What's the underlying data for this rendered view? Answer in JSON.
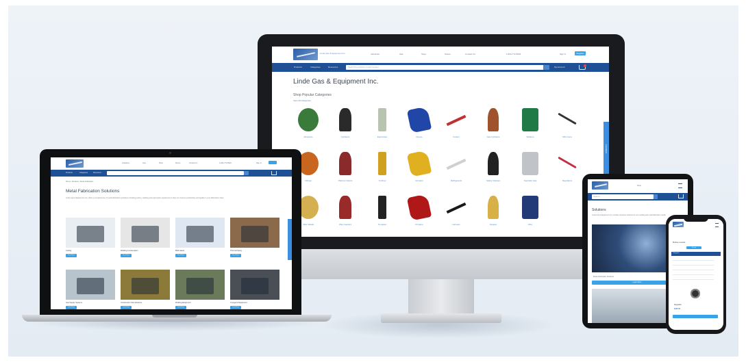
{
  "monitor_site": {
    "nav_links": [
      "Industries",
      "Gas",
      "Shop",
      "Stores",
      "Contact Us"
    ],
    "phone": "1-844-772-5624",
    "account_label": "Sign In",
    "register_label": "Register",
    "menu_items": [
      "Products",
      "Categories",
      "Resources"
    ],
    "search_placeholder": "Search by product or part number",
    "cart_label": "My Account",
    "store_title": "Linde Gas & Equipment Inc.",
    "section_title": "Shop Popular Categories",
    "view_all": "View All Categories",
    "products": [
      {
        "label": "Abrasives",
        "icon": "grinding-disc-icon",
        "color": "#3a7a3a"
      },
      {
        "label": "Cylinders",
        "icon": "gas-cylinder-icon",
        "color": "#2a2a2a"
      },
      {
        "label": "Electrodes",
        "icon": "electrode-icon",
        "color": "#b8c4b0"
      },
      {
        "label": "Gloves",
        "icon": "gloves-icon",
        "color": "#2046a8"
      },
      {
        "label": "Cutters",
        "icon": "cutter-icon",
        "color": "#c03030"
      },
      {
        "label": "Gas Cylinders",
        "icon": "cylinder-icon",
        "color": "#a0522d"
      },
      {
        "label": "Welders",
        "icon": "welder-icon",
        "color": "#1f7a45"
      },
      {
        "label": "MIG Guns",
        "icon": "mig-gun-icon",
        "color": "#333333"
      },
      {
        "label": "Fittings",
        "icon": "fitting-icon",
        "color": "#c8651f"
      },
      {
        "label": "Plasma Cutters",
        "icon": "plasma-icon",
        "color": "#8a2a2a"
      },
      {
        "label": "Torches",
        "icon": "torch-icon",
        "color": "#d0a020"
      },
      {
        "label": "Grinders",
        "icon": "grinder-icon",
        "color": "#e0b020"
      },
      {
        "label": "Refrigerants",
        "icon": "tank-icon",
        "color": "#d0d0d0"
      },
      {
        "label": "Safety Glasses",
        "icon": "glasses-icon",
        "color": "#222222"
      },
      {
        "label": "Specialty Gas",
        "icon": "specialty-gas-icon",
        "color": "#c0c4c8"
      },
      {
        "label": "Regulators",
        "icon": "regulator-icon",
        "color": "#c03040"
      },
      {
        "label": "Filler Metals",
        "icon": "filler-icon",
        "color": "#d4b050"
      },
      {
        "label": "Wire Feeders",
        "icon": "wire-feeder-icon",
        "color": "#9a2a2a"
      },
      {
        "label": "Tungsten",
        "icon": "tungsten-icon",
        "color": "#222222"
      },
      {
        "label": "Propane",
        "icon": "propane-icon",
        "color": "#b01818"
      },
      {
        "label": "Helmets",
        "icon": "helmet-icon",
        "color": "#1a1a1a"
      },
      {
        "label": "Gauges",
        "icon": "gauge-icon",
        "color": "#d8b048"
      },
      {
        "label": "Wire",
        "icon": "wire-spool-icon",
        "color": "#233a78"
      }
    ],
    "side_tab": "Feedback"
  },
  "laptop_site": {
    "nav_links": [
      "Industries",
      "Gas",
      "Shop",
      "Stores",
      "Contact Us"
    ],
    "phone": "1-844-772-5624",
    "account_label": "Sign In",
    "menu_items": [
      "Products",
      "Categories",
      "Resources"
    ],
    "breadcrumb": "Home / Solutions / Metal Fabrication",
    "page_title": "Metal Fabrication Solutions",
    "intro": "Linde Gas & Equipment Inc. offers a complete line of metal fabrication solutions including cutting, welding and automation equipment to help you improve productivity and quality in your fabrication shop.",
    "cards": [
      {
        "label": "Cutting",
        "cta": "Learn More",
        "img": "cutting-table-icon",
        "tone": "#e8eef2"
      },
      {
        "label": "Welding & Automation",
        "cta": "Learn More",
        "img": "welding-cell-icon",
        "tone": "#e6e6e6"
      },
      {
        "label": "Bulk Gases",
        "cta": "Learn More",
        "img": "machine-icon",
        "tone": "#dfe8f2"
      },
      {
        "label": "Thermal Spray",
        "cta": "Learn More",
        "img": "sparks-icon",
        "tone": "#8a6a4a"
      },
      {
        "label": "Gas Supply Systems",
        "cta": "Learn More",
        "img": "tanks-icon",
        "tone": "#b7c4cc"
      },
      {
        "label": "Construction Site Solutions",
        "cta": "Learn More",
        "img": "site-icon",
        "tone": "#8b7a3a"
      },
      {
        "label": "Welding Equipment",
        "cta": "Learn More",
        "img": "workshop-icon",
        "tone": "#6b7a5a"
      },
      {
        "label": "Cryogenic Equipment",
        "cta": "Learn More",
        "img": "equipment-icon",
        "tone": "#4a4f56"
      }
    ]
  },
  "tablet_site": {
    "search_placeholder": "Search",
    "section_title": "Solutions",
    "intro": "Linde Gas & Equipment Inc. provides complete solutions for your welding and metal fabrication needs.",
    "card_label": "Metal Fabrication Solutions",
    "cta": "Learn More"
  },
  "phone_site": {
    "filter_title": "Refine results",
    "sort_label": "Sort by",
    "category_label": "Categories",
    "product_label": "Regulator",
    "price": "$189.99"
  }
}
